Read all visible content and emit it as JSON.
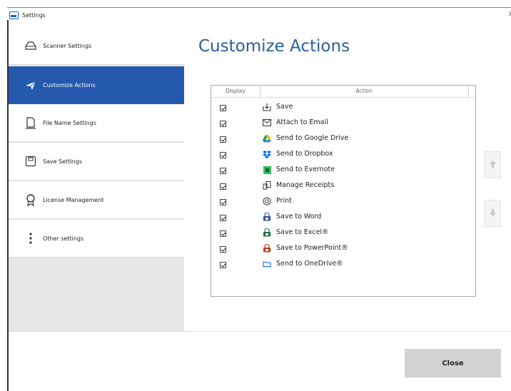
{
  "window": {
    "title": "Settings",
    "close_glyph": "x"
  },
  "sidebar": {
    "items": [
      {
        "label": "Scanner Settings",
        "icon": "scanner-icon",
        "active": false
      },
      {
        "label": "Customize Actions",
        "icon": "send-icon",
        "active": true
      },
      {
        "label": "File Name Settings",
        "icon": "document-icon",
        "active": false
      },
      {
        "label": "Save Settings",
        "icon": "save-settings-icon",
        "active": false
      },
      {
        "label": "License Management",
        "icon": "ribbon-icon",
        "active": false
      },
      {
        "label": "Other settings",
        "icon": "more-vertical-icon",
        "active": false
      }
    ]
  },
  "main": {
    "title": "Customize Actions",
    "list": {
      "columns": [
        "Display",
        "Action"
      ],
      "rows": [
        {
          "checked": true,
          "label": "Save",
          "icon": "save-icon"
        },
        {
          "checked": true,
          "label": "Attach to Email",
          "icon": "email-icon"
        },
        {
          "checked": true,
          "label": "Send to Google Drive",
          "icon": "google-drive-icon"
        },
        {
          "checked": true,
          "label": "Send to Dropbox",
          "icon": "dropbox-icon"
        },
        {
          "checked": true,
          "label": "Send to Evernote",
          "icon": "evernote-icon"
        },
        {
          "checked": true,
          "label": "Manage Receipts",
          "icon": "receipt-icon"
        },
        {
          "checked": true,
          "label": "Print",
          "icon": "print-icon"
        },
        {
          "checked": true,
          "label": "Save to Word",
          "icon": "word-icon"
        },
        {
          "checked": true,
          "label": "Save to Excel®",
          "icon": "excel-icon"
        },
        {
          "checked": true,
          "label": "Save to PowerPoint®",
          "icon": "powerpoint-icon"
        },
        {
          "checked": true,
          "label": "Send to OneDrive®",
          "icon": "onedrive-icon"
        }
      ]
    },
    "move_up_icon": "arrow-up-icon",
    "move_down_icon": "arrow-down-icon"
  },
  "footer": {
    "close_label": "Close"
  },
  "colors": {
    "accent": "#2459ad",
    "title": "#2e5d9e",
    "sidebar_bg": "#e6e6e6",
    "button_bg": "#d2d2d2"
  }
}
